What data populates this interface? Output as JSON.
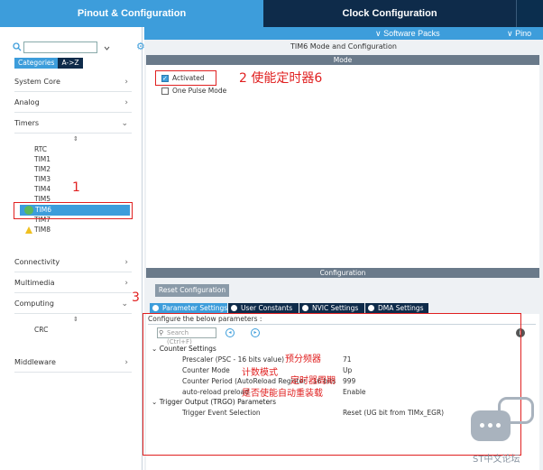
{
  "top_tabs": {
    "pinout": "Pinout & Configuration",
    "clock": "Clock Configuration"
  },
  "secondary_bar": {
    "software_packs": "∨ Software Packs",
    "pinout": "∨ Pino"
  },
  "left_panel": {
    "categories_tab": "Categories",
    "az_tab": "A->Z",
    "groups": {
      "system_core": "System Core",
      "analog": "Analog",
      "timers": "Timers",
      "connectivity": "Connectivity",
      "multimedia": "Multimedia",
      "computing": "Computing",
      "middleware": "Middleware"
    },
    "timers": [
      "RTC",
      "TIM1",
      "TIM2",
      "TIM3",
      "TIM4",
      "TIM5",
      "TIM6",
      "TIM7",
      "TIM8"
    ],
    "computing_items": [
      "CRC"
    ]
  },
  "mode_panel": {
    "title": "TIM6 Mode and Configuration",
    "header": "Mode",
    "activated": "Activated",
    "one_pulse": "One Pulse Mode"
  },
  "config_panel": {
    "header": "Configuration",
    "reset_button": "Reset Configuration",
    "tabs": [
      "Parameter Settings",
      "User Constants",
      "NVIC Settings",
      "DMA Settings"
    ],
    "instruction": "Configure the below parameters :",
    "search_placeholder": "Search (Ctrl+F)",
    "counter_settings": "Counter Settings",
    "params": [
      {
        "name": "Prescaler (PSC - 16 bits value)",
        "value": "71"
      },
      {
        "name": "Counter Mode",
        "value": "Up"
      },
      {
        "name": "Counter Period (AutoReload Register - 16 bits value )",
        "value": "999"
      },
      {
        "name": "auto-reload preload",
        "value": "Enable"
      }
    ],
    "trgo_section": "Trigger Output (TRGO) Parameters",
    "trgo_params": [
      {
        "name": "Trigger Event Selection",
        "value": "Reset (UG bit from TIMx_EGR)"
      }
    ]
  },
  "annotations": {
    "label_1": "1",
    "label_2": "2 使能定时器6",
    "label_3": "3",
    "prescaler_note": "预分频器",
    "counter_mode_note": "计数模式",
    "period_note": "定时器周期",
    "preload_note": "是否使能自动重装载"
  },
  "watermark": "ST中文论坛",
  "colors": {
    "accent": "#3d9ddb",
    "dark": "#0e2b4a",
    "annotation": "#e02020"
  }
}
